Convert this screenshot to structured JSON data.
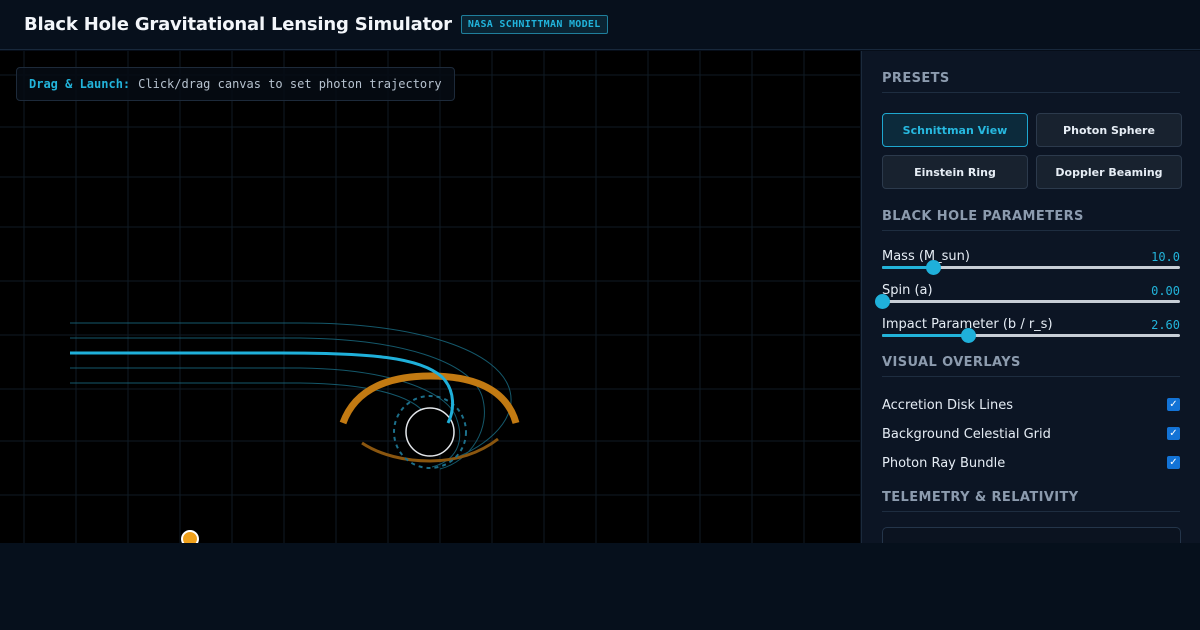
{
  "header": {
    "title": "Black Hole Gravitational Lensing Simulator",
    "badge": "NASA SCHNITTMAN MODEL"
  },
  "viewport": {
    "hint_key": "Drag & Launch:",
    "hint_text": "Click/drag canvas to set photon trajectory"
  },
  "panel": {
    "presets": {
      "title": "PRESETS",
      "items": [
        {
          "label": "Schnittman View",
          "active": true
        },
        {
          "label": "Photon Sphere",
          "active": false
        },
        {
          "label": "Einstein Ring",
          "active": false
        },
        {
          "label": "Doppler Beaming",
          "active": false
        }
      ]
    },
    "parameters": {
      "title": "BLACK HOLE PARAMETERS",
      "items": [
        {
          "label": "Mass (M_sun)",
          "value": "10.0",
          "fraction": 0.17
        },
        {
          "label": "Spin (a)",
          "value": "0.00",
          "fraction": 0.0
        },
        {
          "label": "Impact Parameter (b / r_s)",
          "value": "2.60",
          "fraction": 0.29
        }
      ]
    },
    "overlays": {
      "title": "VISUAL OVERLAYS",
      "items": [
        {
          "label": "Accretion Disk Lines",
          "checked": true
        },
        {
          "label": "Background Celestial Grid",
          "checked": true
        },
        {
          "label": "Photon Ray Bundle",
          "checked": true
        }
      ]
    },
    "telemetry": {
      "title": "TELEMETRY & RELATIVITY"
    }
  },
  "colors": {
    "accent": "#22b3da",
    "disk": "#c27a12",
    "photon": "#1fb0da",
    "checkbox": "#1373d6"
  }
}
